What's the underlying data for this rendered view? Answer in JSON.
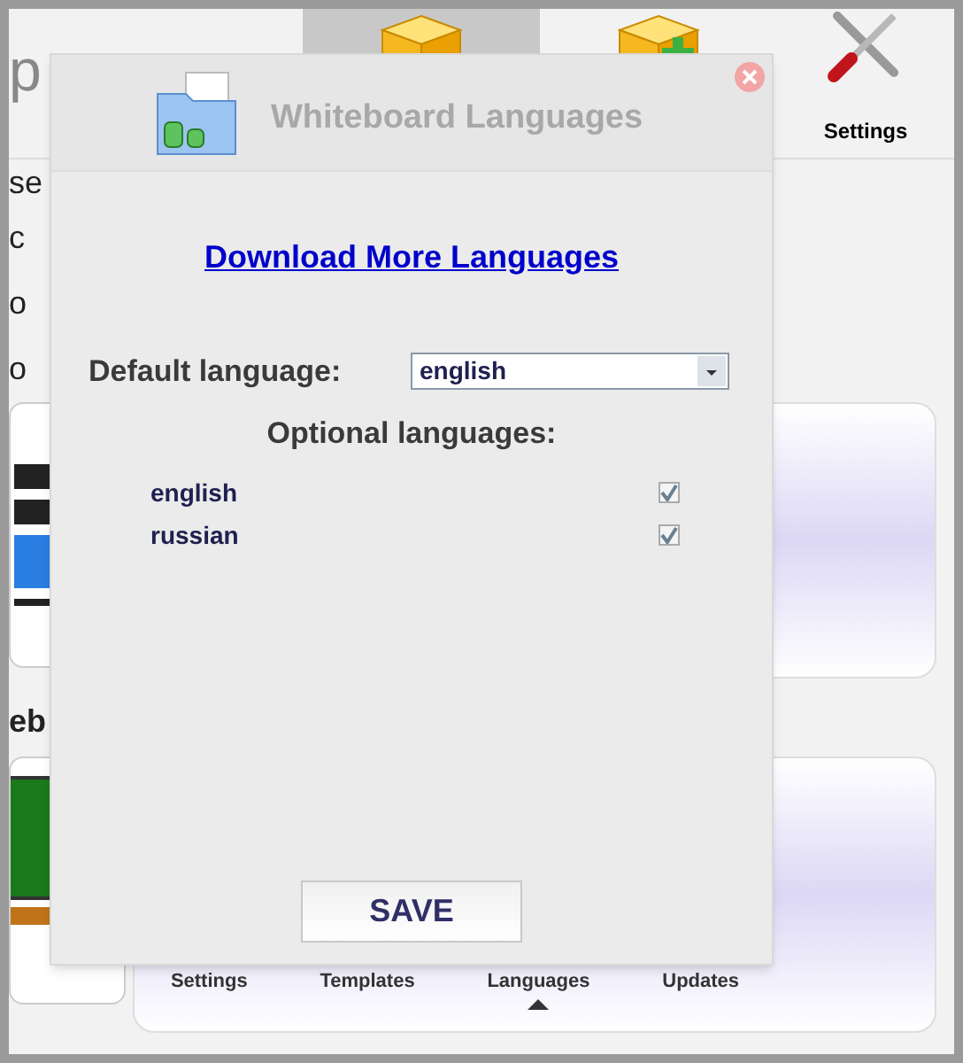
{
  "app": {
    "title": "p",
    "top_tabs": [
      {
        "selected": true,
        "kind": "cube"
      },
      {
        "selected": false,
        "kind": "cube-plus"
      },
      {
        "label": "Settings",
        "selected": false,
        "kind": "tools"
      }
    ],
    "byline": "se",
    "left_texts": [
      "c",
      "o",
      "o"
    ],
    "section_label": "eb",
    "bottom_tabs": [
      {
        "label": "Settings",
        "selected": false
      },
      {
        "label": "Templates",
        "selected": false
      },
      {
        "label": "Languages",
        "selected": true
      },
      {
        "label": "Updates",
        "selected": false
      }
    ]
  },
  "dialog": {
    "title": "Whiteboard Languages",
    "link": "Download More Languages",
    "default_label": "Default language:",
    "default_value": "english",
    "optional_label": "Optional languages:",
    "languages": [
      {
        "name": "english",
        "checked": true
      },
      {
        "name": "russian",
        "checked": true
      }
    ],
    "save": "SAVE"
  }
}
